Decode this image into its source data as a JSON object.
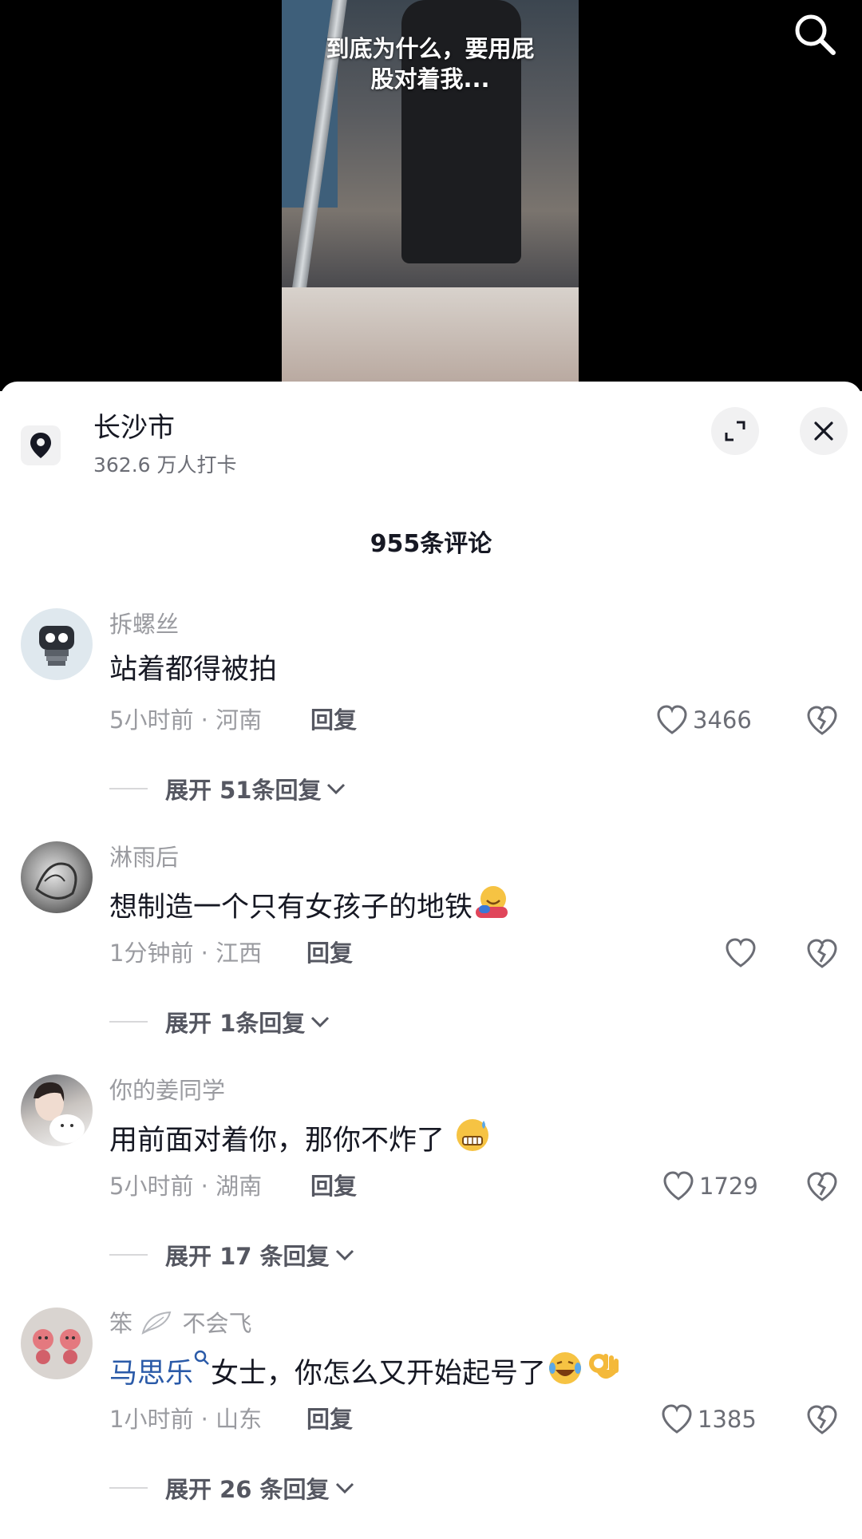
{
  "video": {
    "caption_line1": "到底为什么，要用屁",
    "caption_line2": "股对着我..."
  },
  "location": {
    "title": "长沙市",
    "subtitle": "362.6 万人打卡"
  },
  "comments_header": {
    "count_label": "955条评论"
  },
  "comments": [
    {
      "username": "拆螺丝",
      "text": "站着都得被拍",
      "time_location": "5小时前 · 河南",
      "reply_label": "回复",
      "likes": "3466",
      "expand_label": "展开 51条回复"
    },
    {
      "username": "淋雨后",
      "text": "想制造一个只有女孩子的地铁",
      "time_location": "1分钟前 · 江西",
      "reply_label": "回复",
      "likes": "",
      "expand_label": "展开 1条回复"
    },
    {
      "username": "你的姜同学",
      "text": "用前面对着你，那你不炸了",
      "time_location": "5小时前 · 湖南",
      "reply_label": "回复",
      "likes": "1729",
      "expand_label": "展开 17 条回复"
    },
    {
      "username_part1": "笨",
      "username_part2": "不会飞",
      "mention": "马思乐",
      "text": "女士，你怎么又开始起号了",
      "time_location": "1小时前 · 山东",
      "reply_label": "回复",
      "likes": "1385",
      "expand_label": "展开 26 条回复"
    }
  ],
  "colors": {
    "text_primary": "#161823",
    "text_secondary": "#9a9ba0",
    "mention_blue": "#2a5aa8",
    "video_bg": "#000000"
  }
}
